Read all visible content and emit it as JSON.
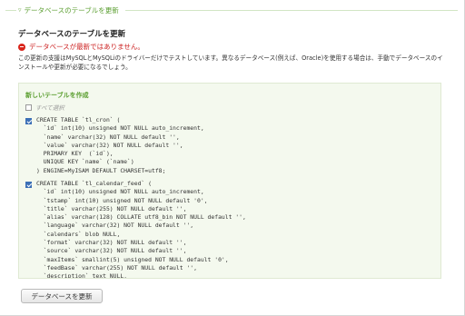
{
  "section": {
    "legend": "データベースのテーブルを更新",
    "heading": "データベースのテーブルを更新",
    "error": "データベースが最新ではありません。",
    "description": "この更新の支援はMySQLとMySQLiのドライバーだけでテストしています。異なるデータベース(例えば、Oracle)を使用する場合は、手動でデータベースのインストールや更新が必要になるでしょう。"
  },
  "panel": {
    "title": "新しいテーブルを作成",
    "select_all": "すべて選択",
    "statements": [
      {
        "checked": true,
        "sql": "CREATE TABLE `tl_cron` (\n  `id` int(10) unsigned NOT NULL auto_increment,\n  `name` varchar(32) NOT NULL default '',\n  `value` varchar(32) NOT NULL default '',\n  PRIMARY KEY  (`id`),\n  UNIQUE KEY `name` (`name`)\n) ENGINE=MyISAM DEFAULT CHARSET=utf8;"
      },
      {
        "checked": true,
        "sql": "CREATE TABLE `tl_calendar_feed` (\n  `id` int(10) unsigned NOT NULL auto_increment,\n  `tstamp` int(10) unsigned NOT NULL default '0',\n  `title` varchar(255) NOT NULL default '',\n  `alias` varchar(128) COLLATE utf8_bin NOT NULL default '',\n  `language` varchar(32) NOT NULL default '',\n  `calendars` blob NULL,\n  `format` varchar(32) NOT NULL default '',\n  `source` varchar(32) NOT NULL default '',\n  `maxItems` smallint(5) unsigned NOT NULL default '0',\n  `feedBase` varchar(255) NOT NULL default '',\n  `description` text NULL,"
      }
    ]
  },
  "buttons": {
    "update": "データベースを更新"
  }
}
